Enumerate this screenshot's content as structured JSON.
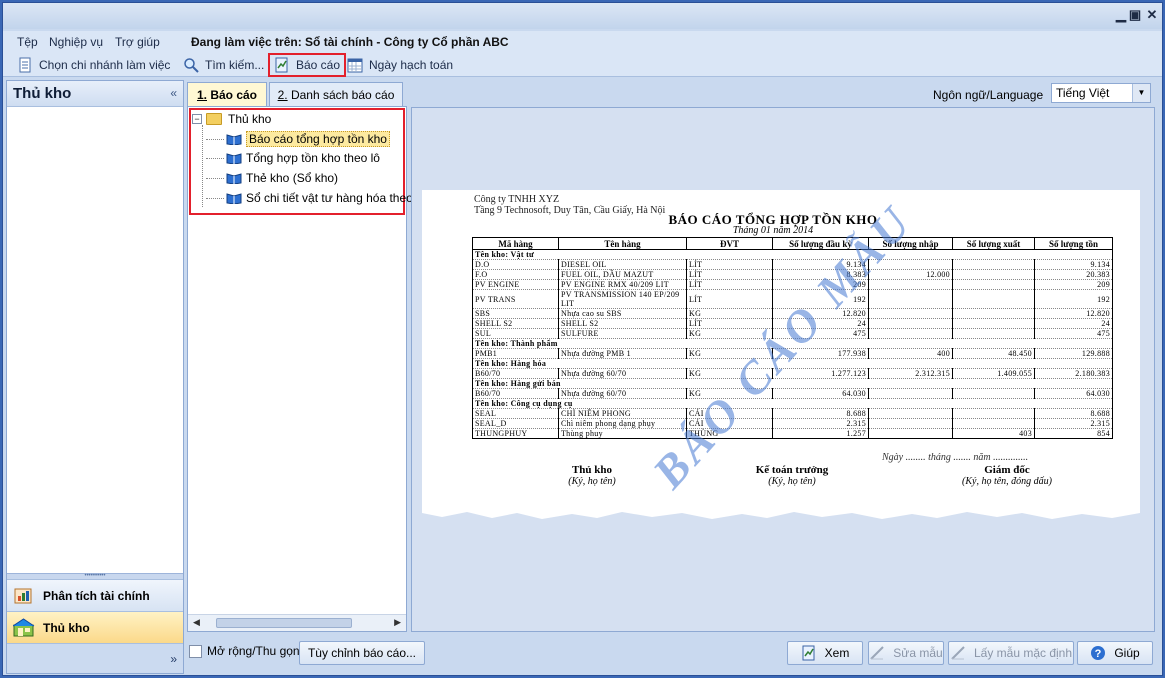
{
  "menu": {
    "items": [
      "Tệp",
      "Nghiệp vụ",
      "Trợ giúp"
    ],
    "working_on": "Đang làm việc trên: Sổ tài chính - Công ty Cổ phần ABC"
  },
  "toolbar": {
    "branch": "Chọn chi nhánh làm việc",
    "search": "Tìm kiếm...",
    "report": "Báo cáo",
    "posting_date": "Ngày hạch toán"
  },
  "sidebar": {
    "title": "Thủ kho",
    "nav": [
      {
        "label": "Phân tích tài chính",
        "icon": "finance-analysis-icon"
      },
      {
        "label": "Thủ kho",
        "icon": "warehouse-icon"
      }
    ]
  },
  "tabs": [
    {
      "key": "1",
      "label": "1. Báo cáo",
      "underline": "1.",
      "rest": " Báo cáo"
    },
    {
      "key": "2",
      "label": "2. Danh sách báo cáo",
      "underline": "2.",
      "rest": " Danh sách báo cáo"
    }
  ],
  "tree": {
    "root": "Thủ kho",
    "items": [
      "Báo cáo tổng hợp tồn kho",
      "Tổng hợp tồn kho theo lô",
      "Thẻ kho (Sổ kho)",
      "Sổ chi tiết vật tư hàng hóa theo"
    ]
  },
  "language": {
    "label": "Ngôn ngữ/Language",
    "value": "Tiếng Việt"
  },
  "report": {
    "company": "Công ty TNHH XYZ",
    "address": "Tầng 9 Technosoft, Duy Tân, Cầu Giấy, Hà Nội",
    "title": "BÁO CÁO TỔNG HỢP TỒN KHO",
    "period": "Tháng 01 năm 2014",
    "headers": [
      "Mã hàng",
      "Tên hàng",
      "ĐVT",
      "Số lượng đầu kỳ",
      "Số lượng nhập",
      "Số lượng xuất",
      "Số lượng tồn"
    ],
    "groups": [
      {
        "name": "Tên kho: Vật tư",
        "rows": [
          [
            "D.O",
            "DIESEL OIL",
            "LÍT",
            "9.134",
            "",
            "",
            "9.134"
          ],
          [
            "F.O",
            "FUEL OIL, DẦU MAZUT",
            "LÍT",
            "8.383",
            "12.000",
            "",
            "20.383"
          ],
          [
            "PV ENGINE",
            "PV ENGINE RMX 40/209 LIT",
            "LÍT",
            "209",
            "",
            "",
            "209"
          ],
          [
            "PV TRANS",
            "PV TRANSMISSION 140 EP/209 LIT",
            "LÍT",
            "192",
            "",
            "",
            "192"
          ],
          [
            "SBS",
            "Nhựa cao su SBS",
            "KG",
            "12.820",
            "",
            "",
            "12.820"
          ],
          [
            "SHELL S2",
            "SHELL S2",
            "LÍT",
            "24",
            "",
            "",
            "24"
          ],
          [
            "SUL",
            "SULFURE",
            "KG",
            "475",
            "",
            "",
            "475"
          ]
        ]
      },
      {
        "name": "Tên kho: Thành phẩm",
        "rows": [
          [
            "PMB1",
            "Nhựa đường PMB 1",
            "KG",
            "177.938",
            "400",
            "48.450",
            "129.888"
          ]
        ]
      },
      {
        "name": "Tên kho: Hàng hóa",
        "rows": [
          [
            "B60/70",
            "Nhựa đường 60/70",
            "KG",
            "1.277.123",
            "2.312.315",
            "1.409.055",
            "2.180.383"
          ]
        ]
      },
      {
        "name": "Tên kho: Hàng gửi bán",
        "rows": [
          [
            "B60/70",
            "Nhựa đường 60/70",
            "KG",
            "64.030",
            "",
            "",
            "64.030"
          ]
        ]
      },
      {
        "name": "Tên kho: Công cụ dụng cụ",
        "rows": [
          [
            "SEAL",
            "CHÌ NIÊM PHONG",
            "CÁI",
            "8.688",
            "",
            "",
            "8.688"
          ],
          [
            "SEAL_D",
            "Chì niêm phong dạng phụy",
            "CÁI",
            "2.315",
            "",
            "",
            "2.315"
          ],
          [
            "THUNGPHUY",
            "Thùng phuy",
            "THÙNG",
            "1.257",
            "",
            "403",
            "854"
          ]
        ]
      }
    ],
    "date_line": "Ngày ........ tháng ....... năm ..............",
    "signatures": [
      {
        "title": "Thủ kho",
        "note": "(Ký, họ tên)"
      },
      {
        "title": "Kế toán trưởng",
        "note": "(Ký, họ tên)"
      },
      {
        "title": "Giám đốc",
        "note": "(Ký, họ tên, đóng dấu)"
      }
    ],
    "watermark": "BÁO CÁO MẪU"
  },
  "bottom": {
    "expand_label": "Mở rộng/Thu gọn",
    "customize": "Tùy chỉnh báo cáo...",
    "view": "Xem",
    "edit_template": "Sửa mẫu",
    "default_template": "Lấy mẫu mặc định",
    "help": "Giúp"
  }
}
